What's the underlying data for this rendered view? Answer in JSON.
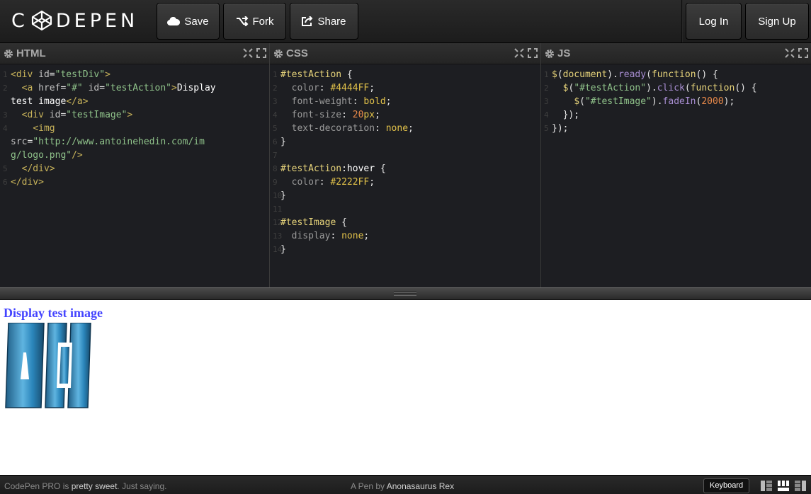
{
  "header": {
    "logo": "CODEPEN",
    "buttons": {
      "save": "Save",
      "fork": "Fork",
      "share": "Share"
    },
    "auth": {
      "login": "Log In",
      "signup": "Sign Up"
    }
  },
  "editors": {
    "html": {
      "title": "HTML",
      "line_numbers": [
        "1",
        "2",
        "",
        "3",
        "4",
        "",
        "",
        "5",
        "6"
      ]
    },
    "css": {
      "title": "CSS",
      "line_numbers": [
        "1",
        "2",
        "3",
        "4",
        "5",
        "6",
        "7",
        "8",
        "9",
        "10",
        "11",
        "12",
        "13",
        "14"
      ]
    },
    "js": {
      "title": "JS",
      "line_numbers": [
        "1",
        "2",
        "3",
        "4",
        "5"
      ]
    }
  },
  "code": {
    "html": [
      "<div id=\"testDiv\">",
      "  <a href=\"#\" id=\"testAction\">Display",
      "test image</a>",
      "  <div id=\"testImage\">",
      "    <img",
      "src=\"http://www.antoinehedin.com/im",
      "g/logo.png\"/>",
      "  </div>",
      "</div>"
    ],
    "css": [
      "#testAction {",
      "  color: #4444FF;",
      "  font-weight: bold;",
      "  font-size: 20px;",
      "  text-decoration: none;",
      "}",
      "",
      "#testAction:hover {",
      "  color: #2222FF;",
      "}",
      "",
      "#testImage {",
      "  display: none;",
      "}"
    ],
    "js": [
      "$(document).ready(function() {",
      "  $(\"#testAction\").click(function() {",
      "    $(\"#testImage\").fadeIn(2000);",
      "  });",
      "});"
    ]
  },
  "preview": {
    "link_text": "Display test image"
  },
  "footer": {
    "promo_prefix": "CodePen PRO is ",
    "promo_bold": "pretty sweet",
    "promo_suffix": ". Just saying.",
    "credit_prefix": "A Pen by ",
    "credit_author": "Anonasaurus Rex",
    "keyboard": "Keyboard"
  },
  "colors": {
    "link": "#4444FF",
    "logo_blue": "#2a7fb0",
    "editor_bg": "#1d1e22"
  }
}
